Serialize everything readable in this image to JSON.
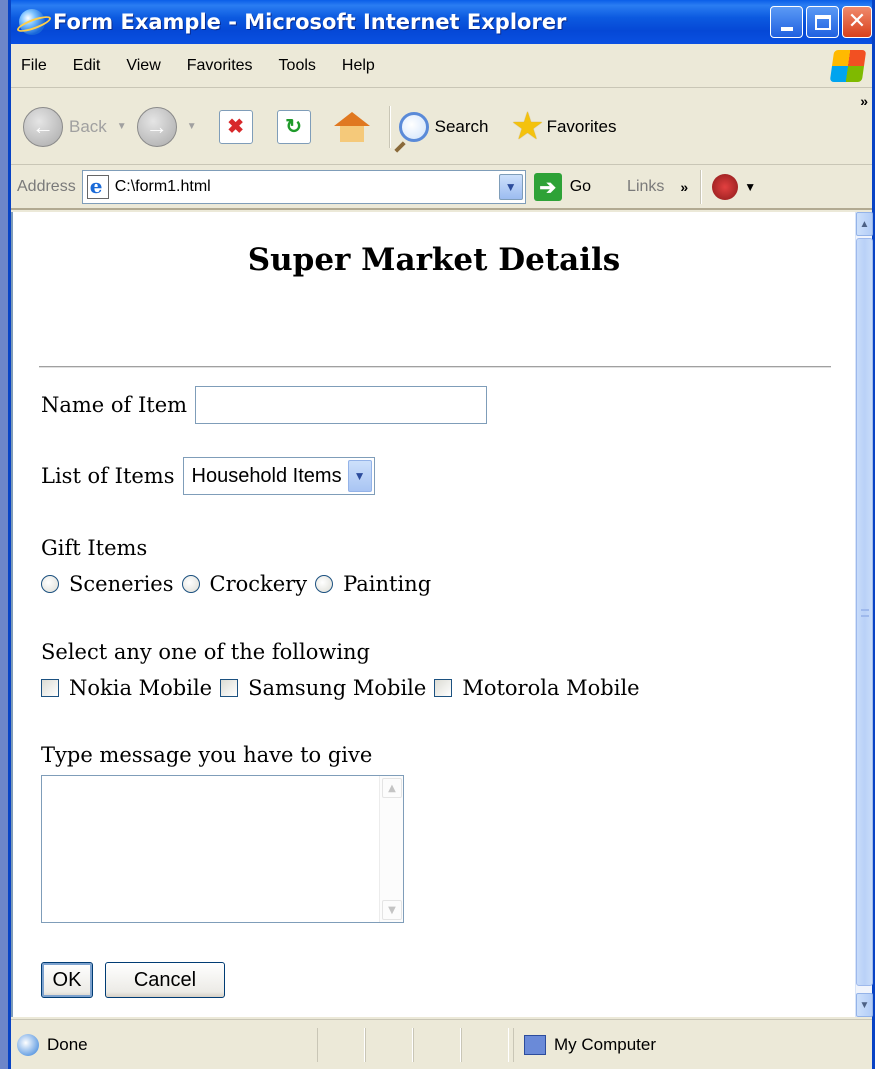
{
  "window": {
    "title": "Form Example - Microsoft Internet Explorer"
  },
  "menu": [
    "File",
    "Edit",
    "View",
    "Favorites",
    "Tools",
    "Help"
  ],
  "toolbar": {
    "back": "Back",
    "search": "Search",
    "favorites": "Favorites",
    "more": "»"
  },
  "addressbar": {
    "label": "Address",
    "url": "C:\\form1.html",
    "go": "Go",
    "links": "Links",
    "links_more": "»"
  },
  "page": {
    "heading": "Super Market Details",
    "name_label": "Name of Item",
    "name_value": "",
    "list_label": "List of Items",
    "list_selected": "Household Items",
    "gift_label": "Gift Items",
    "gift_options": [
      "Sceneries",
      "Crockery",
      "Painting"
    ],
    "select_label": "Select any one of the following",
    "check_options": [
      "Nokia Mobile",
      "Samsung Mobile",
      "Motorola Mobile"
    ],
    "message_label": "Type message you have to give",
    "message_value": "",
    "ok_label": "OK",
    "cancel_label": "Cancel"
  },
  "status": {
    "text": "Done",
    "zone": "My Computer"
  },
  "colors": {
    "titlebar": "#0548d6",
    "chrome": "#ece9d8",
    "content_bg": "#ffffff"
  }
}
